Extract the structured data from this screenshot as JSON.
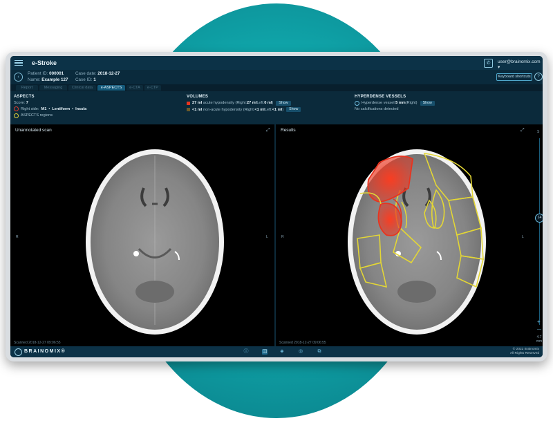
{
  "app": {
    "title": "e-Stroke",
    "user_email": "user@brainomix.com ▾",
    "keyboard_shortcuts": "Keyboard shortcuts"
  },
  "patient": {
    "id_label": "Patient ID:",
    "id_value": "000001",
    "name_label": "Name:",
    "name_value": "Example 127",
    "case_date_label": "Case date:",
    "case_date_value": "2018-12-27",
    "case_id_label": "Case ID:",
    "case_id_value": "1"
  },
  "tabs": [
    {
      "label": "Report"
    },
    {
      "label": "Messaging"
    },
    {
      "label": "Clinical data"
    },
    {
      "label": "e-ASPECTS"
    },
    {
      "label": "e-CTA"
    },
    {
      "label": "e-CTP"
    }
  ],
  "aspects": {
    "title": "ASPECTS",
    "score_label": "Score:",
    "score_value": "7",
    "right_side_label": "Right side:",
    "regions": [
      "M1",
      "Lentiform",
      "Insula"
    ],
    "regions_label": "ASPECTS regions"
  },
  "volumes": {
    "title": "VOLUMES",
    "acute_value": "27 ml",
    "acute_text": "acute hypodensity (Right: ",
    "acute_right": "27 ml",
    "acute_mid": " Left: ",
    "acute_left": "0 ml",
    "acute_end": ")",
    "nonacute_value": "<1 ml",
    "nonacute_text": "non-acute hypodensity (Right: ",
    "nonacute_right": "<1 ml",
    "nonacute_mid": " Left: ",
    "nonacute_left": "<1 ml",
    "nonacute_end": ")",
    "show_label": "Show"
  },
  "hyperdense": {
    "title": "HYPERDENSE VESSELS",
    "vessel_text": "Hyperdense vessel: ",
    "vessel_value": "5 mm",
    "vessel_side": " (Right)",
    "calcification_text": "No calcifications detected",
    "show_label": "Show"
  },
  "viewer": {
    "left_label": "Unannotated scan",
    "right_label": "Results",
    "side_r": "R",
    "side_l": "L",
    "slider_top": "S",
    "slice_number": "14",
    "zoom_plus": "+",
    "zoom_minus": "—",
    "slice_thickness": "4.7 mm",
    "scanned_left": "Scanned 2018-12-27 09:06:55",
    "scanned_right": "Scanned 2018-12-27 09:06:55"
  },
  "footer": {
    "brand": "BRAINOMIX®",
    "copyright_line1": "© 2022 Brainomix",
    "copyright_line2": "All Rights Reserved"
  },
  "colors": {
    "accent": "#1bc1c3",
    "lesion": "#e8341f",
    "region": "#e3d635",
    "panel": "#0b2a3b"
  },
  "icons": [
    "menu-icon",
    "phone-icon",
    "back-icon",
    "help-icon",
    "expand-icon",
    "info-icon",
    "split-view-icon",
    "layers-icon",
    "target-icon",
    "export-icon"
  ]
}
